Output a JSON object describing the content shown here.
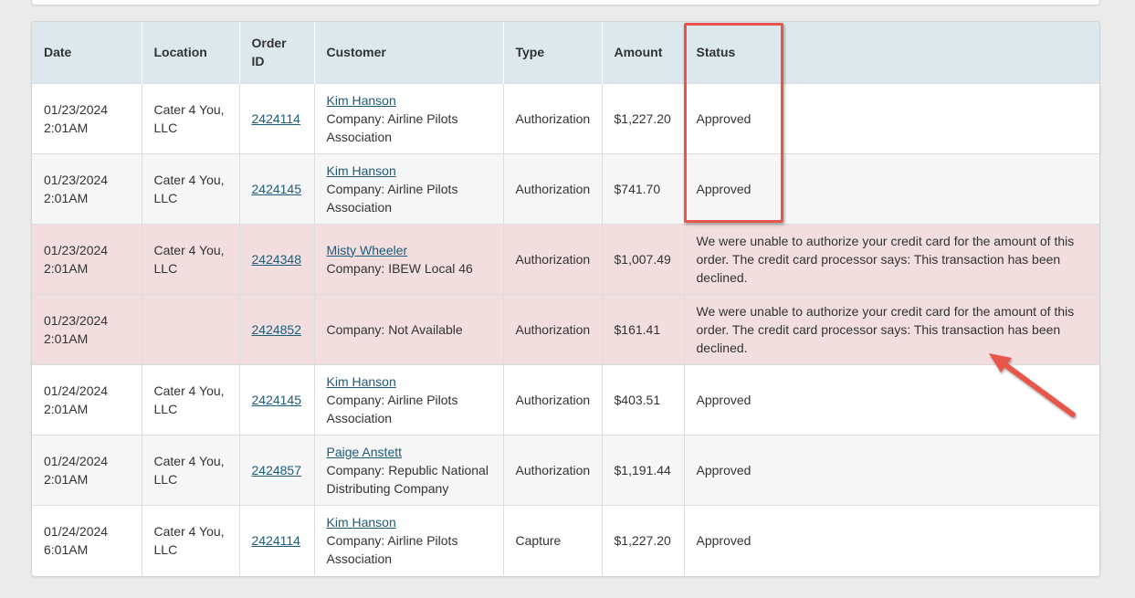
{
  "table": {
    "headers": {
      "date": "Date",
      "location": "Location",
      "order_id_line1": "Order",
      "order_id_line2": "ID",
      "customer": "Customer",
      "type": "Type",
      "amount": "Amount",
      "status": "Status"
    },
    "rows": [
      {
        "date": "01/23/2024",
        "time": "2:01AM",
        "location_line1": "Cater 4 You,",
        "location_line2": "LLC",
        "order_id": "2424114",
        "customer_name": "Kim Hanson",
        "company_line1": "Company: Airline Pilots",
        "company_line2": "Association",
        "type": "Authorization",
        "amount": "$1,227.20",
        "status": "Approved"
      },
      {
        "date": "01/23/2024",
        "time": "2:01AM",
        "location_line1": "Cater 4 You,",
        "location_line2": "LLC",
        "order_id": "2424145",
        "customer_name": "Kim Hanson",
        "company_line1": "Company: Airline Pilots",
        "company_line2": "Association",
        "type": "Authorization",
        "amount": "$741.70",
        "status": "Approved"
      },
      {
        "date": "01/23/2024",
        "time": "2:01AM",
        "location_line1": "Cater 4 You,",
        "location_line2": "LLC",
        "order_id": "2424348",
        "customer_name": "Misty Wheeler",
        "company_line1": "Company: IBEW Local 46",
        "company_line2": "",
        "type": "Authorization",
        "amount": "$1,007.49",
        "status": "We were unable to authorize your credit card for the amount of this order. The credit card processor says: This transaction has been declined."
      },
      {
        "date": "01/23/2024",
        "time": "2:01AM",
        "location_line1": "",
        "location_line2": "",
        "order_id": "2424852",
        "customer_name": "",
        "company_line1": "Company: Not Available",
        "company_line2": "",
        "type": "Authorization",
        "amount": "$161.41",
        "status": "We were unable to authorize your credit card for the amount of this order. The credit card processor says: This transaction has been declined."
      },
      {
        "date": "01/24/2024",
        "time": "2:01AM",
        "location_line1": "Cater 4 You,",
        "location_line2": "LLC",
        "order_id": "2424145",
        "customer_name": "Kim Hanson",
        "company_line1": "Company: Airline Pilots",
        "company_line2": "Association",
        "type": "Authorization",
        "amount": "$403.51",
        "status": "Approved"
      },
      {
        "date": "01/24/2024",
        "time": "2:01AM",
        "location_line1": "Cater 4 You,",
        "location_line2": "LLC",
        "order_id": "2424857",
        "customer_name": "Paige Anstett",
        "company_line1": "Company: Republic National",
        "company_line2": "Distributing Company",
        "type": "Authorization",
        "amount": "$1,191.44",
        "status": "Approved"
      },
      {
        "date": "01/24/2024",
        "time": "6:01AM",
        "location_line1": "Cater 4 You,",
        "location_line2": "LLC",
        "order_id": "2424114",
        "customer_name": "Kim Hanson",
        "company_line1": "Company: Airline Pilots",
        "company_line2": "Association",
        "type": "Capture",
        "amount": "$1,227.20",
        "status": "Approved"
      }
    ]
  },
  "colors": {
    "header_bg": "#dce8ec",
    "declined_row_bg": "#f2dede",
    "alt_row_bg": "#f6f6f6",
    "link": "#1c5c7a",
    "annotation": "#e8554a"
  }
}
